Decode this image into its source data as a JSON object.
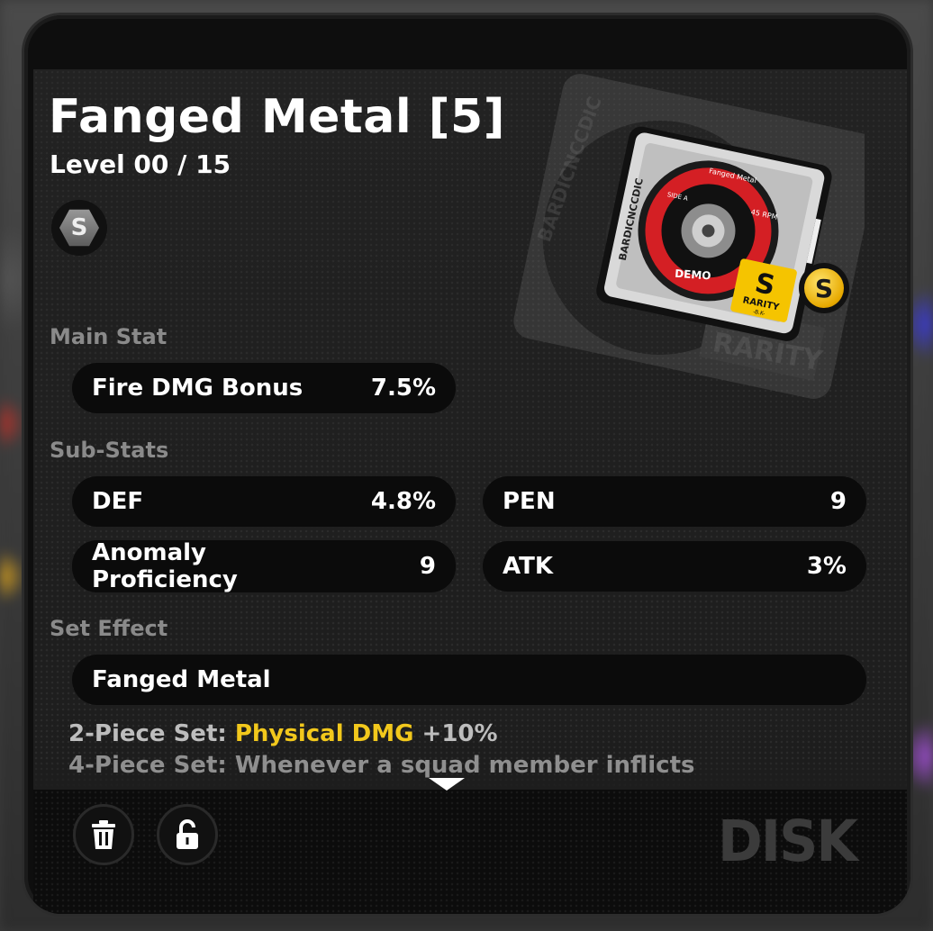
{
  "disc": {
    "title": "Fanged Metal [5]",
    "level": "Level 00 / 15",
    "rank": "S",
    "rarity_badge": "S",
    "art_labels": {
      "brand": "BARDICNCCDIC",
      "demo": "DEMO",
      "rarity_letter": "S",
      "rarity_word": "RARITY",
      "rarity_sub": "-B.K-",
      "rpm": "45 RPM",
      "side": "SIDE A",
      "record_title": "Fanged Metal"
    }
  },
  "main_stat": {
    "label": "Main Stat",
    "name": "Fire DMG Bonus",
    "value": "7.5%"
  },
  "sub_stats": {
    "label": "Sub-Stats",
    "items": [
      {
        "name": "DEF",
        "value": "4.8%"
      },
      {
        "name": "PEN",
        "value": "9"
      },
      {
        "name": "Anomaly Proficiency",
        "value": "9"
      },
      {
        "name": "ATK",
        "value": "3%"
      }
    ]
  },
  "set_effect": {
    "label": "Set Effect",
    "name": "Fanged Metal",
    "two_piece_prefix": "2-Piece Set:",
    "two_piece_highlight": "Physical DMG",
    "two_piece_suffix": "+10%",
    "four_piece": "4-Piece Set: Whenever a squad member inflicts"
  },
  "footer": {
    "category": "DISK",
    "delete_icon": "trash-icon",
    "lock_icon": "unlock-icon"
  },
  "colors": {
    "highlight": "#f2c81c",
    "section_label": "#8a8a8a",
    "disc_red": "#d41f24",
    "rarity_yellow": "#f5c400"
  }
}
